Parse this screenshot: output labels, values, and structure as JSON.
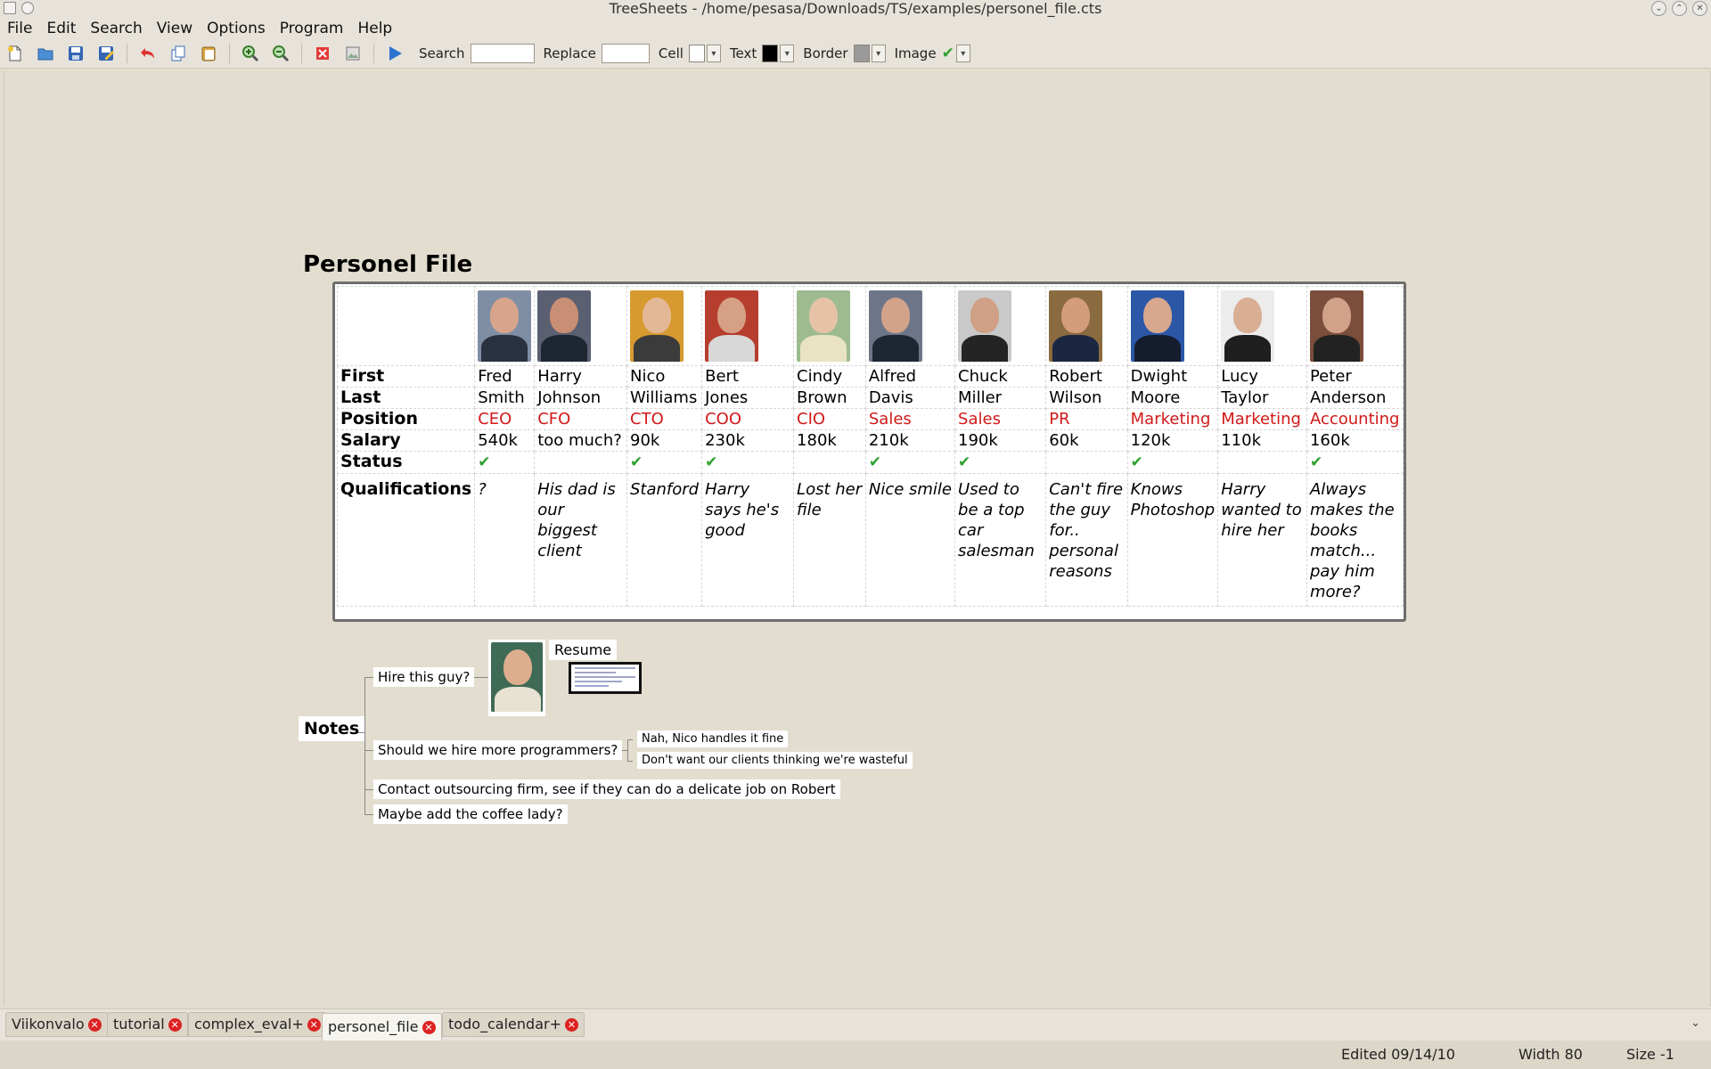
{
  "window": {
    "title": "TreeSheets - /home/pesasa/Downloads/TS/examples/personel_file.cts",
    "controls": [
      "minimize",
      "maximize",
      "close"
    ]
  },
  "menu": [
    "File",
    "Edit",
    "Search",
    "View",
    "Options",
    "Program",
    "Help"
  ],
  "toolbar": {
    "icons": [
      "new-file-icon",
      "open-folder-icon",
      "save-icon",
      "save-as-icon",
      "undo-icon",
      "copy-icon",
      "paste-icon",
      "zoom-in-icon",
      "zoom-out-icon",
      "delete-icon",
      "image-icon",
      "run-icon"
    ],
    "search_label": "Search",
    "search_value": "",
    "replace_label": "Replace",
    "replace_value": "",
    "cell_label": "Cell",
    "cell_color": "#ffffff",
    "text_label": "Text",
    "text_color": "#000000",
    "border_label": "Border",
    "border_color": "#9a9a9a",
    "image_label": "Image"
  },
  "document": {
    "title": "Personel File",
    "row_headers": {
      "first": "First",
      "last": "Last",
      "position": "Position",
      "salary": "Salary",
      "status": "Status",
      "qualifications": "Qualifications"
    },
    "people": [
      {
        "first": "Fred",
        "last": "Smith",
        "position": "CEO",
        "salary": "540k",
        "status": true,
        "qualifications": "?",
        "photo": {
          "bg": "#7f8ea4",
          "skin": "#d9a48c",
          "suit": "#2a3140"
        }
      },
      {
        "first": "Harry",
        "last": "Johnson",
        "position": "CFO",
        "salary": "too much?",
        "status": false,
        "qualifications": "His dad is our biggest client",
        "photo": {
          "bg": "#5a6072",
          "skin": "#c98f74",
          "suit": "#1f2633"
        }
      },
      {
        "first": "Nico",
        "last": "Williams",
        "position": "CTO",
        "salary": "90k",
        "status": true,
        "qualifications": "Stanford",
        "photo": {
          "bg": "#d79a2f",
          "skin": "#e4b896",
          "suit": "#3b3b3b"
        }
      },
      {
        "first": "Bert",
        "last": "Jones",
        "position": "COO",
        "salary": "230k",
        "status": true,
        "qualifications": "Harry says he's good",
        "photo": {
          "bg": "#b63e2e",
          "skin": "#d6a085",
          "suit": "#d8d8d8"
        }
      },
      {
        "first": "Cindy",
        "last": "Brown",
        "position": "CIO",
        "salary": "180k",
        "status": false,
        "qualifications": "Lost her file",
        "photo": {
          "bg": "#9dbb8e",
          "skin": "#e6c3a7",
          "suit": "#e9e2c4"
        }
      },
      {
        "first": "Alfred",
        "last": "Davis",
        "position": "Sales",
        "salary": "210k",
        "status": true,
        "qualifications": "Nice smile",
        "photo": {
          "bg": "#6d7688",
          "skin": "#d2a389",
          "suit": "#1f2633"
        }
      },
      {
        "first": "Chuck",
        "last": "Miller",
        "position": "Sales",
        "salary": "190k",
        "status": true,
        "qualifications": "Used to be a top car salesman",
        "photo": {
          "bg": "#c9c9c9",
          "skin": "#cf9f86",
          "suit": "#242424"
        }
      },
      {
        "first": "Robert",
        "last": "Wilson",
        "position": "PR",
        "salary": "60k",
        "status": false,
        "qualifications": "Can't fire the guy for.. personal reasons",
        "photo": {
          "bg": "#8a6a3f",
          "skin": "#d39c7b",
          "suit": "#1b2740"
        }
      },
      {
        "first": "Dwight",
        "last": "Moore",
        "position": "Marketing",
        "salary": "120k",
        "status": true,
        "qualifications": "Knows Photoshop",
        "photo": {
          "bg": "#2b57a6",
          "skin": "#d7a88e",
          "suit": "#141c2e"
        }
      },
      {
        "first": "Lucy",
        "last": "Taylor",
        "position": "Marketing",
        "salary": "110k",
        "status": false,
        "qualifications": "Harry wanted to hire her",
        "photo": {
          "bg": "#ececec",
          "skin": "#d9ae94",
          "suit": "#1f1f1f"
        }
      },
      {
        "first": "Peter",
        "last": "Anderson",
        "position": "Accounting",
        "salary": "160k",
        "status": true,
        "qualifications": "Always makes the books match... pay him more?",
        "photo": {
          "bg": "#7a4e3a",
          "skin": "#d2a189",
          "suit": "#222"
        }
      }
    ],
    "status_icon": "check-icon",
    "notes": {
      "root": "Notes",
      "hire_guy": "Hire this guy?",
      "resume_label": "Resume",
      "more_programmers": "Should we hire more programmers?",
      "reply_1": "Nah, Nico handles it fine",
      "reply_2": "Don't want our clients thinking we're wasteful",
      "outsourcing": "Contact outsourcing firm, see if they can do a delicate job on Robert",
      "coffee": "Maybe add the coffee lady?"
    }
  },
  "tabs": [
    {
      "label": "Viikonvalo",
      "active": false
    },
    {
      "label": "tutorial",
      "active": false
    },
    {
      "label": "complex_eval+",
      "active": false
    },
    {
      "label": "personel_file",
      "active": true
    },
    {
      "label": "todo_calendar+",
      "active": false
    }
  ],
  "status": {
    "edited": "Edited 09/14/10",
    "width": "Width 80",
    "size": "Size -1"
  }
}
